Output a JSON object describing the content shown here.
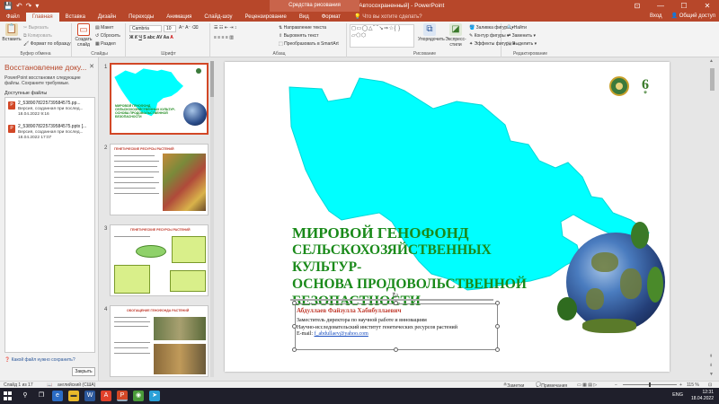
{
  "titlebar": {
    "doc_title": "2_5389078225739584575.pptx [Автосохраненный] - PowerPoint",
    "context_tab": "Средства рисования",
    "save_icon": "save-icon",
    "undo_icon": "undo-icon",
    "redo_icon": "redo-icon",
    "minimize": "—",
    "maximize": "☐",
    "close": "✕"
  },
  "tabs": {
    "items": [
      "Файл",
      "Главная",
      "Вставка",
      "Дизайн",
      "Переходы",
      "Анимация",
      "Слайд-шоу",
      "Рецензирование",
      "Вид",
      "Формат"
    ],
    "tellme": "Что вы хотите сделать?",
    "signin": "Вход",
    "share": "Общий доступ"
  },
  "ribbon": {
    "clipboard": {
      "paste": "Вставить",
      "cut": "Вырезать",
      "copy": "Копировать",
      "format_painter": "Формат по образцу",
      "label": "Буфер обмена"
    },
    "slides": {
      "new_slide": "Создать слайд",
      "layout": "Макет",
      "reset": "Сбросить",
      "section": "Раздел",
      "label": "Слайды"
    },
    "font": {
      "name": "Cambria",
      "size": "10",
      "label": "Шрифт"
    },
    "paragraph": {
      "direction": "Направление текста",
      "align": "Выровнять текст",
      "smartart": "Преобразовать в SmartArt",
      "label": "Абзац"
    },
    "drawing": {
      "shapes": "◻▭◯△⌒↘⇒☆{ }▱⬠⬡",
      "arrange": "Упорядочить",
      "quick_styles": "Экспресс-стили",
      "fill": "Заливка фигуры",
      "outline": "Контур фигуры",
      "effects": "Эффекты фигуры",
      "label": "Рисование"
    },
    "editing": {
      "find": "Найти",
      "replace": "Заменить",
      "select": "Выделить",
      "label": "Редактирование"
    }
  },
  "recovery": {
    "title": "Восстановление доку...",
    "description": "PowerPoint восстановил следующие файлы. Сохраните требуемые.",
    "available": "Доступные файлы",
    "files": [
      {
        "name": "2_5389078225739584575.pp...",
        "version": "Версия, созданная при послед...",
        "date": "18.04.2022 9:16"
      },
      {
        "name": "2_5389078225739584575.pptx [...",
        "version": "Версия, созданная при послед...",
        "date": "18.04.2022 17:07"
      }
    ],
    "help": "Какой файл нужно сохранить?",
    "close_button": "Закрыть"
  },
  "thumbnails": {
    "numbers": [
      "1",
      "2",
      "3",
      "4"
    ],
    "slide1_title": "МИРОВОЙ ГЕНОФОНД СЕЛЬСКОХОЗЯЙСТВЕННЫХ КУЛЬТУР- ОСНОВА ПРОДОВОЛЬСТВЕННОЙ БЕЗОПАСНОСТИ",
    "slide2_title": "ГЕНЕТИЧЕСКИЕ РЕСУРСЫ РАСТЕНИЙ",
    "slide3_title": "ГЕНЕТИЧЕСКИЕ РЕСУРСЫ РАСТЕНИЙ",
    "slide4_title": "ОБОГАЩЕНИЕ ГЕНОФОНДА РАСТЕНИЙ"
  },
  "slide": {
    "title_line1": "МИРОВОЙ ГЕНОФОНД",
    "title_line2": "СЕЛЬСКОХОЗЯЙСТВЕННЫХ КУЛЬТУР-",
    "title_line3": "ОСНОВА ПРОДОВОЛЬСТВЕННОЙ",
    "title_line4": "БЕЗОПАСТНОСТИ",
    "author": "Абдуллаев Файзулла Хабибуллаевич",
    "role1": "Заместитель директора по научной работе и внновациям",
    "role2": "Научно-исследовательский институт генетических ресурсов растений",
    "email_label": "E-mail: ",
    "email": "f_abdullaev@yahoo.com",
    "map_color": "#00ffff",
    "title_color": "#1a8a1a",
    "author_color": "#c0392b"
  },
  "statusbar": {
    "slide_info": "Слайд 1 из 17",
    "language": "английский (США)",
    "notes": "Заметки",
    "comments": "Примечания",
    "zoom": "115 %"
  },
  "taskbar": {
    "lang": "ENG",
    "time": "12:31",
    "date": "18.04.2022"
  }
}
